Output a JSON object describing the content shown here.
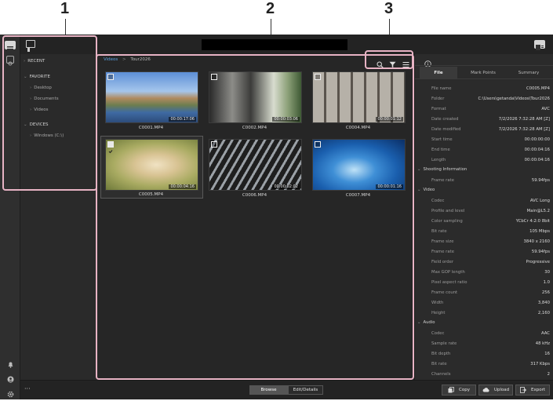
{
  "callouts": [
    "1",
    "2",
    "3"
  ],
  "sidebar": {
    "sections": [
      {
        "label": "RECENT"
      },
      {
        "label": "FAVORITE",
        "items": [
          "Desktop",
          "Documents",
          "Videos"
        ]
      },
      {
        "label": "DEVICES",
        "items": [
          "Windows (C:\\)"
        ]
      }
    ]
  },
  "breadcrumb": {
    "root": "Videos",
    "sep": ">",
    "current": "Tour2026"
  },
  "clips": [
    {
      "name": "C0001.MP4",
      "duration": "00:00:17:06",
      "checked": false
    },
    {
      "name": "C0002.MP4",
      "duration": "00:00:03:06",
      "checked": false
    },
    {
      "name": "C0004.MP4",
      "duration": "00:00:01:12",
      "checked": false
    },
    {
      "name": "C0005.MP4",
      "duration": "00:00:04:16",
      "checked": true
    },
    {
      "name": "C0006.MP4",
      "duration": "00:00:02:02",
      "checked": false
    },
    {
      "name": "C0007.MP4",
      "duration": "00:00:01:16",
      "checked": false
    }
  ],
  "right_tabs": [
    "File",
    "Mark Points",
    "Summary"
  ],
  "file_props": [
    [
      "File name",
      "C0005.MP4"
    ],
    [
      "Folder",
      "C:\\Users\\getanda\\Videos\\Tour2026"
    ],
    [
      "Format",
      "AVC"
    ],
    [
      "Date created",
      "7/2/2026 7:32:28 AM [Z]"
    ],
    [
      "Date modified",
      "7/2/2026 7:32:28 AM [Z]"
    ],
    [
      "Start time",
      "00:00:00:00"
    ],
    [
      "End time",
      "00:00:04:16"
    ],
    [
      "Length",
      "00:00:04:16"
    ]
  ],
  "shooting_title": "Shooting Information",
  "shooting_props": [
    [
      "Frame rate",
      "59.94fps"
    ]
  ],
  "video_title": "Video",
  "video_props": [
    [
      "Codec",
      "AVC Long"
    ],
    [
      "Profile and level",
      "Main@L5.2"
    ],
    [
      "Color sampling",
      "YCbCr 4:2:0 8bit"
    ],
    [
      "Bit rate",
      "105 Mbps"
    ],
    [
      "Frame size",
      "3840 x 2160"
    ],
    [
      "Frame rate",
      "59.94fps"
    ],
    [
      "Field order",
      "Progressive"
    ],
    [
      "Max GOP length",
      "30"
    ],
    [
      "Pixel aspect ratio",
      "1.0"
    ],
    [
      "Frame count",
      "256"
    ],
    [
      "Width",
      "3,840"
    ],
    [
      "Height",
      "2,160"
    ]
  ],
  "audio_title": "Audio",
  "audio_props": [
    [
      "Codec",
      "AAC"
    ],
    [
      "Sample rate",
      "48 kHz"
    ],
    [
      "Bit depth",
      "16"
    ],
    [
      "Bit rate",
      "317 Kbps"
    ],
    [
      "Channels",
      "2"
    ]
  ],
  "bottom": {
    "more": "···",
    "mode_browse": "Browse",
    "mode_edit": "Edit/Details",
    "copy": "Copy",
    "upload": "Upload",
    "export": "Export"
  },
  "icons": [
    "browser-mode-icon",
    "media-view-icon",
    "panel-toggle-icon",
    "right-panel-icon",
    "info-icon",
    "search-icon",
    "filter-icon",
    "menu-icon",
    "bell-icon",
    "account-icon",
    "settings-icon",
    "copy-icon",
    "cloud-upload-icon",
    "export-icon"
  ]
}
